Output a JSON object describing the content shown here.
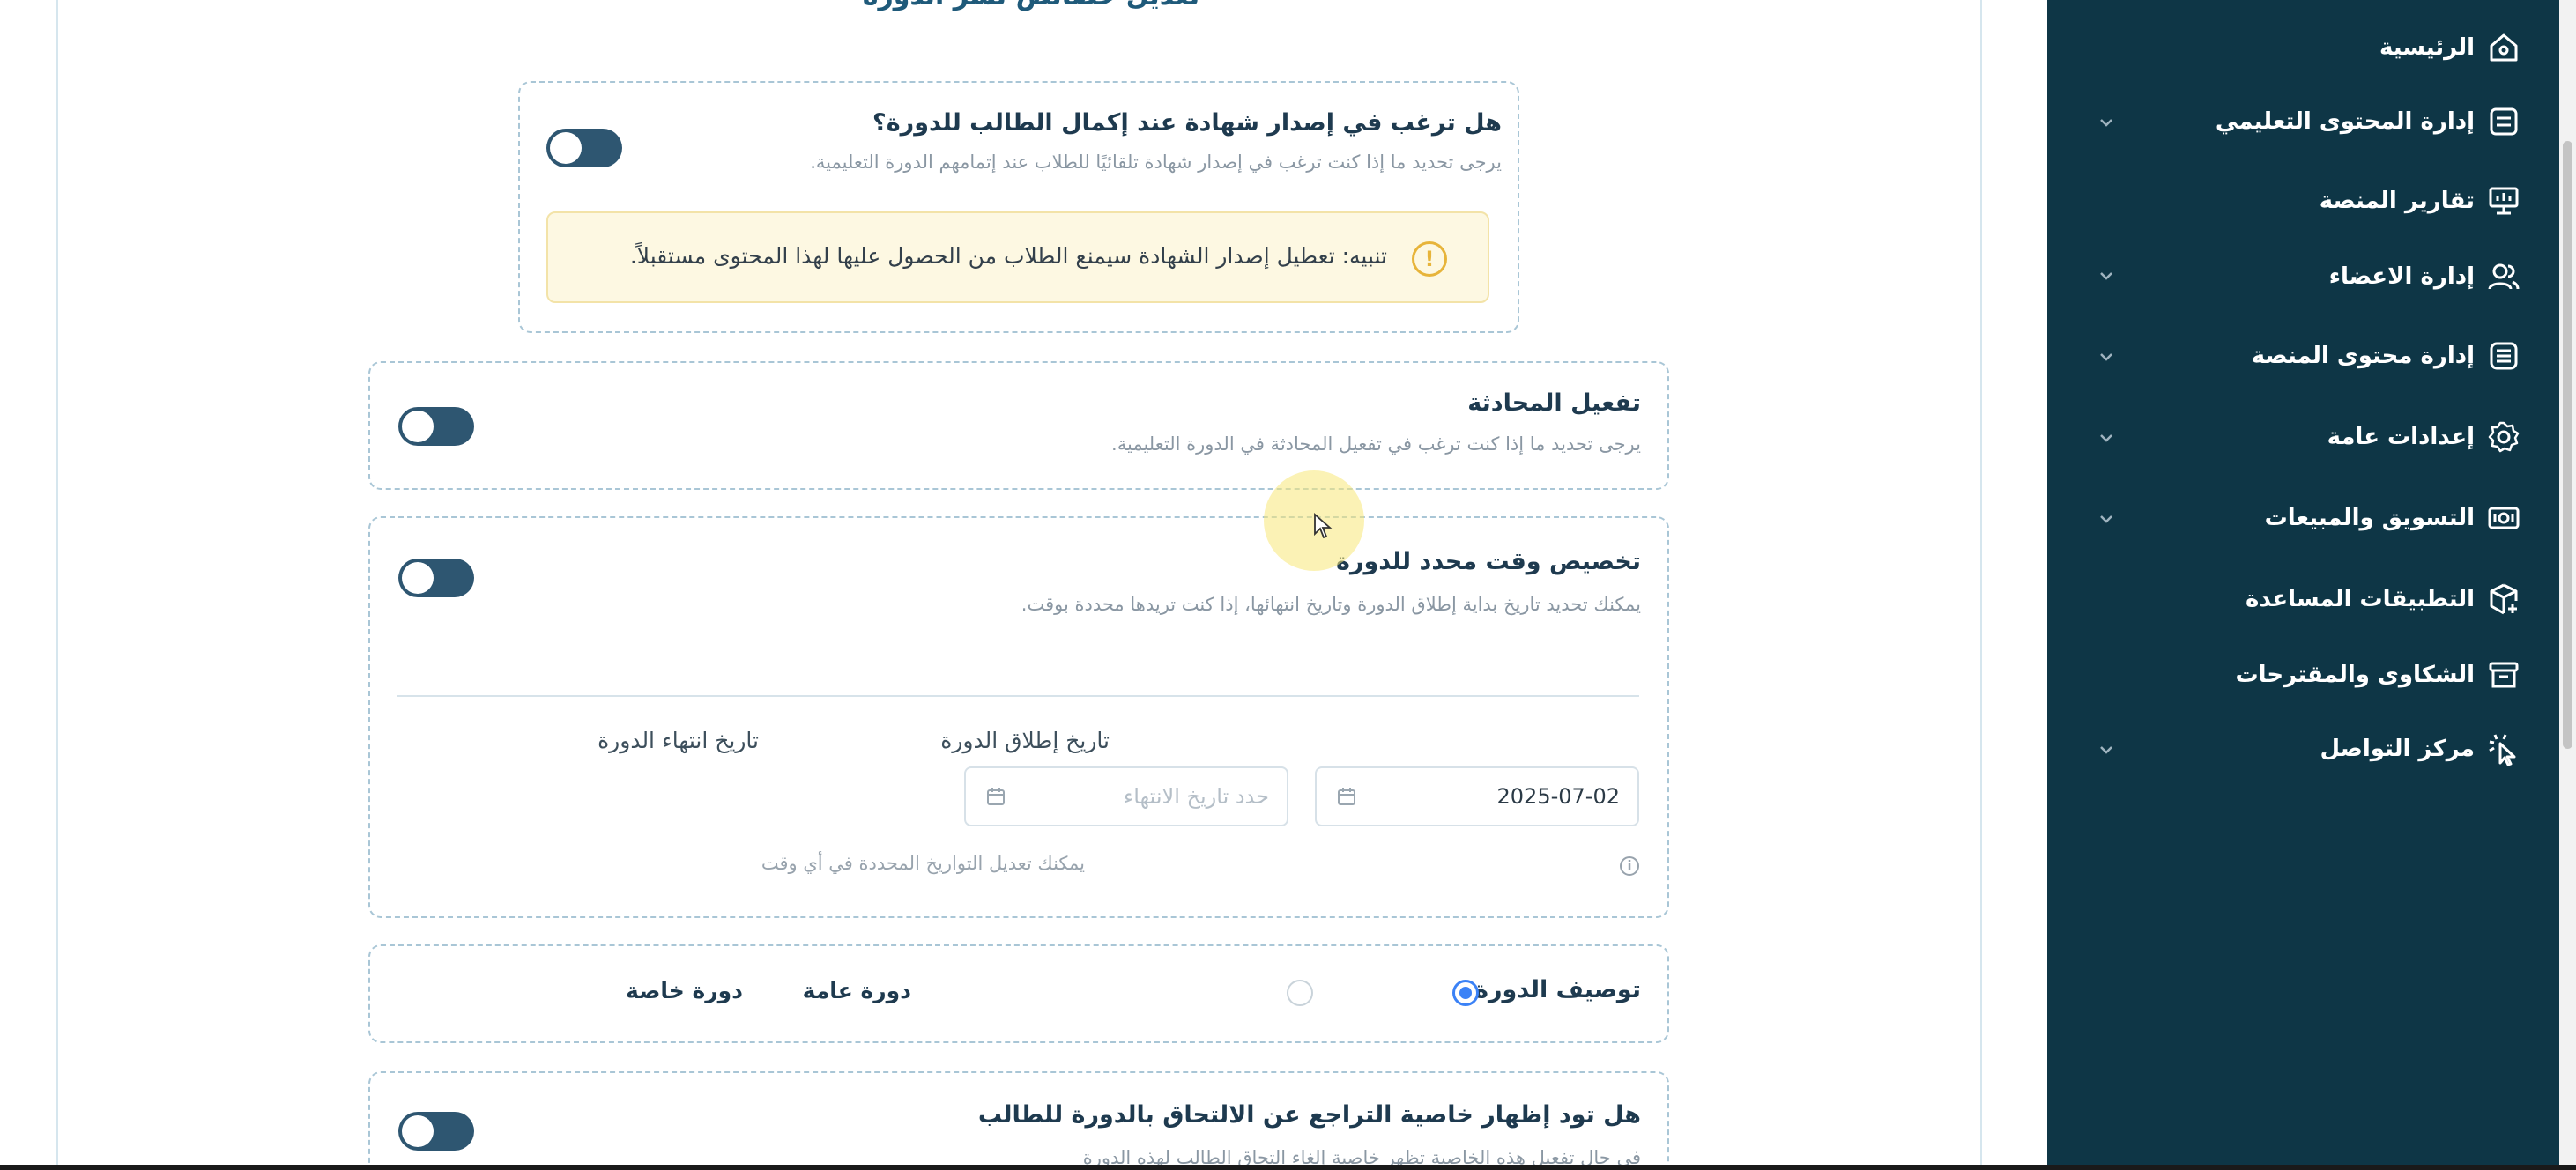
{
  "page": {
    "title": "تعديل خصائص نشر الدورة"
  },
  "certificate": {
    "title": "هل ترغب في إصدار شهادة عند إكمال الطالب للدورة؟",
    "description": "يرجى تحديد ما إذا كنت ترغب في إصدار شهادة تلقائيًا للطلاب عند إتمامهم الدورة التعليمية.",
    "warning_icon": "!",
    "warning": "تنبيه: تعطيل إصدار الشهادة سيمنع الطلاب من الحصول عليها لهذا المحتوى مستقبلاً.",
    "enabled": false
  },
  "chat": {
    "title": "تفعيل المحادثة",
    "description": "يرجى تحديد ما إذا كنت ترغب في تفعيل المحادثة في الدورة التعليمية.",
    "enabled": false
  },
  "schedule": {
    "title": "تخصيص وقت محدد للدورة",
    "description": "يمكنك تحديد تاريخ بداية إطلاق الدورة وتاريخ انتهائها، إذا كنت تريدها محددة بوقت.",
    "enabled": false,
    "start_label": "تاريخ إطلاق الدورة",
    "start_value": "2025-07-02",
    "end_label": "تاريخ انتهاء الدورة",
    "end_placeholder": "حدد تاريخ الانتهاء",
    "hint_icon": "i",
    "hint": "يمكنك تعديل التواريخ المحددة في أي وقت"
  },
  "course_type": {
    "label": "توصيف الدورة:",
    "options": [
      {
        "label": "دورة عامة",
        "selected": true
      },
      {
        "label": "دورة خاصة",
        "selected": false
      }
    ]
  },
  "withdraw": {
    "title": "هل تود إظهار خاصية التراجع عن الالتحاق بالدورة للطالب",
    "description": "في حال تفعيل هذه الخاصية تظهر خاصية إلغاء التحاق الطالب لهذه الدورة",
    "enabled": false
  },
  "sidebar": {
    "items": [
      {
        "label": "الرئيسية",
        "icon": "home-icon",
        "has_children": false
      },
      {
        "label": "إدارة المحتوى التعليمي",
        "icon": "content-icon",
        "has_children": true
      },
      {
        "label": "تقارير المنصة",
        "icon": "presentation-icon",
        "has_children": false
      },
      {
        "label": "إدارة الاعضاء",
        "icon": "users-icon",
        "has_children": true
      },
      {
        "label": "إدارة محتوى المنصة",
        "icon": "list-icon",
        "has_children": true
      },
      {
        "label": "إعدادات عامة",
        "icon": "gear-icon",
        "has_children": true
      },
      {
        "label": "التسويق والمبيعات",
        "icon": "money-icon",
        "has_children": true
      },
      {
        "label": "التطبيقات المساعدة",
        "icon": "box-plus-icon",
        "has_children": false
      },
      {
        "label": "الشكاوى والمقترحات",
        "icon": "archive-icon",
        "has_children": false
      },
      {
        "label": "مركز التواصل",
        "icon": "pointer-click-icon",
        "has_children": true
      }
    ]
  },
  "colors": {
    "sidebar_bg": "#0e3646",
    "toggle_off": "#2e5671",
    "radio_accent": "#3b82f6",
    "warning_bg": "#fdf8e2"
  }
}
